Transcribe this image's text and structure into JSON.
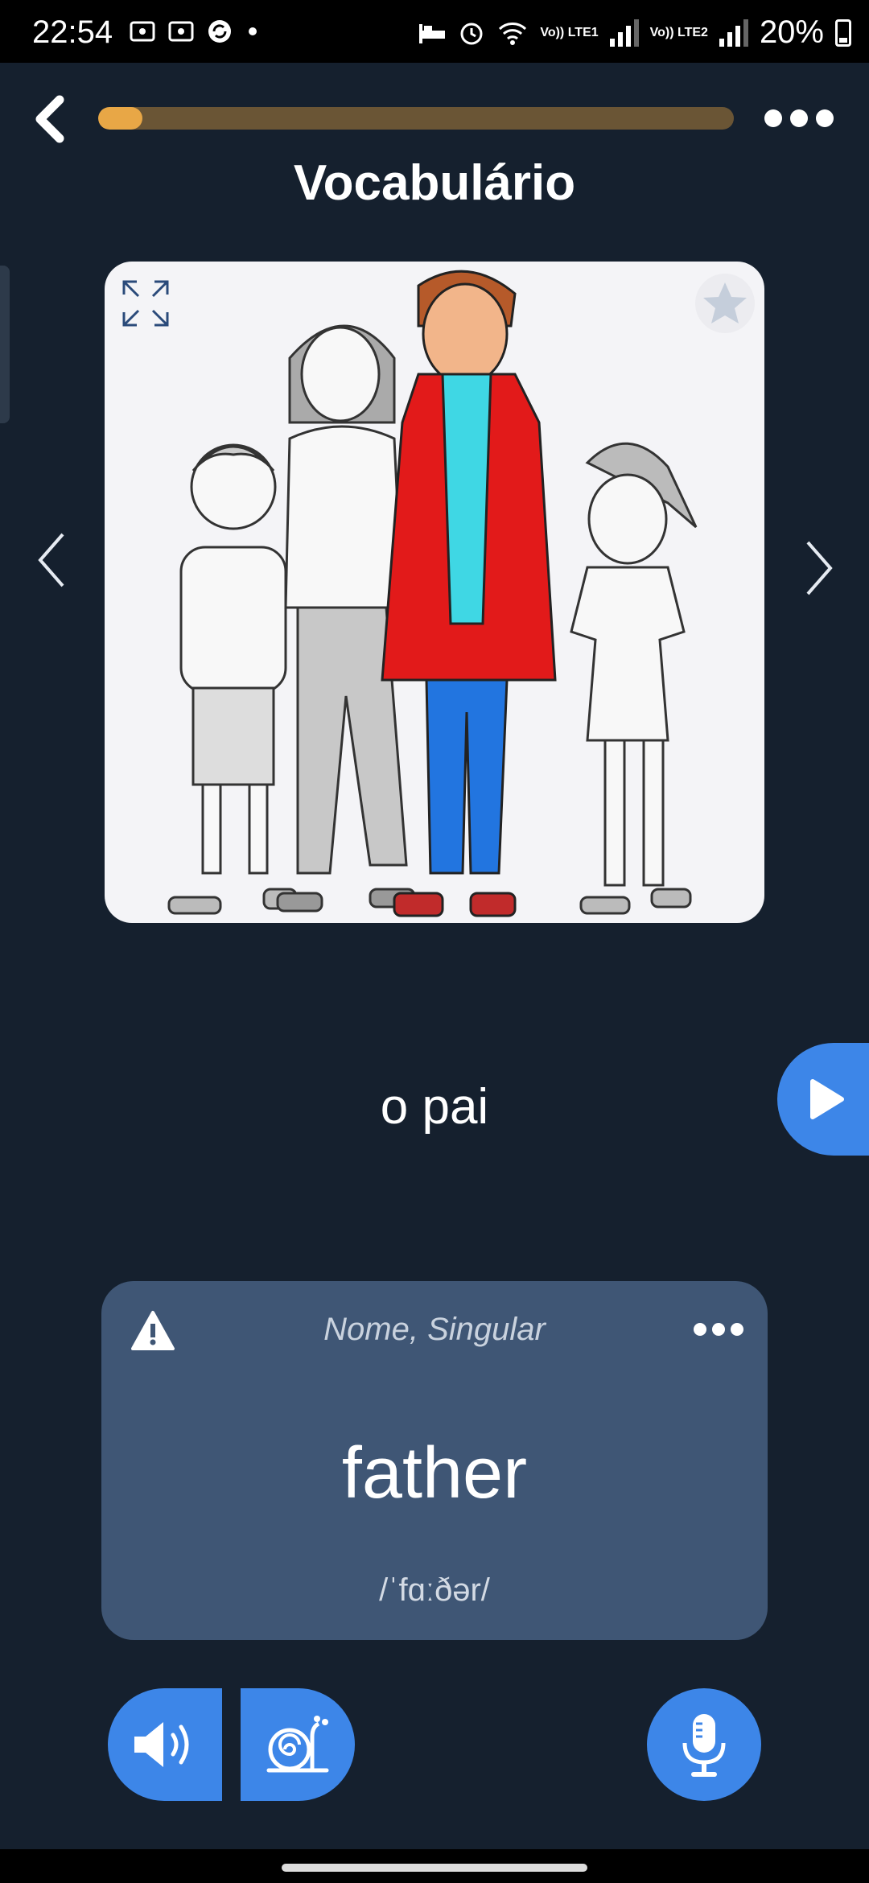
{
  "status_bar": {
    "time": "22:54",
    "battery": "20%",
    "sim1": "Vo)) LTE1",
    "sim2": "Vo)) LTE2"
  },
  "header": {
    "title": "Vocabulário",
    "progress": 0.07
  },
  "flashcard": {
    "word": "o pai",
    "image_icon": "family-illustration"
  },
  "translation_card": {
    "part_of_speech": "Nome, Singular",
    "translation": "father",
    "phonetic": "/ˈfɑːðər/"
  },
  "icons": {
    "back": "chevron-left-icon",
    "menu": "more-dots-icon",
    "expand": "expand-icon",
    "favorite": "star-icon",
    "prev": "chevron-left-icon",
    "next": "chevron-right-icon",
    "play": "play-icon",
    "warning": "warning-icon",
    "speaker": "speaker-icon",
    "slow": "snail-icon",
    "mic": "microphone-icon"
  },
  "colors": {
    "background": "#15202e",
    "accent": "#3d86e8",
    "progress_fill": "#e8a746",
    "progress_track": "#6a5535",
    "card": "#3f5675"
  }
}
